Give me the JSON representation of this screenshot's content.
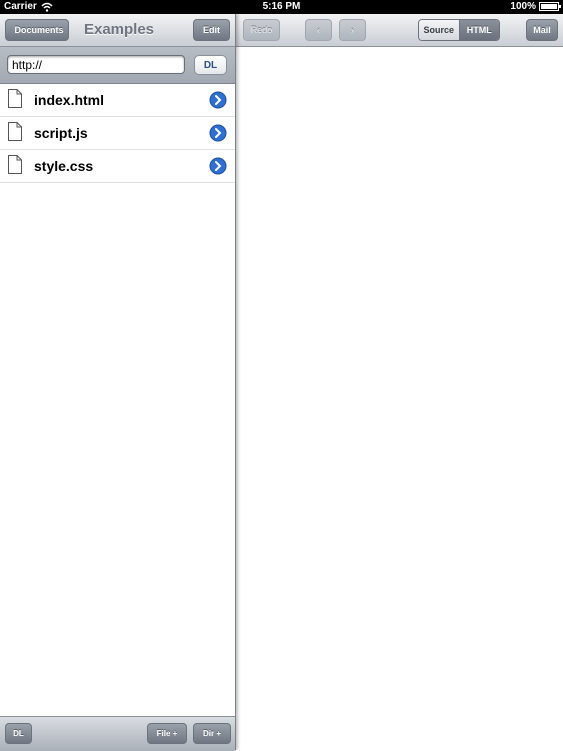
{
  "status_bar": {
    "carrier": "Carrier",
    "time": "5:16 PM",
    "battery": "100%"
  },
  "sidebar": {
    "back_label": "Documents",
    "title": "Examples",
    "edit_label": "Edit",
    "url_value": "http://",
    "dl_top_label": "DL",
    "files": [
      {
        "name": "index.html"
      },
      {
        "name": "script.js"
      },
      {
        "name": "style.css"
      }
    ],
    "bottom": {
      "dl_label": "DL",
      "file_label": "File +",
      "dir_label": "Dir +"
    }
  },
  "editor": {
    "redo_label": "Redo",
    "prev_label": "‹",
    "next_label": "›",
    "source_label": "Source",
    "html_label": "HTML",
    "mail_label": "Mail"
  },
  "colors": {
    "accent_blue": "#2f6fd1",
    "toolbar_button": "#6f7782"
  }
}
